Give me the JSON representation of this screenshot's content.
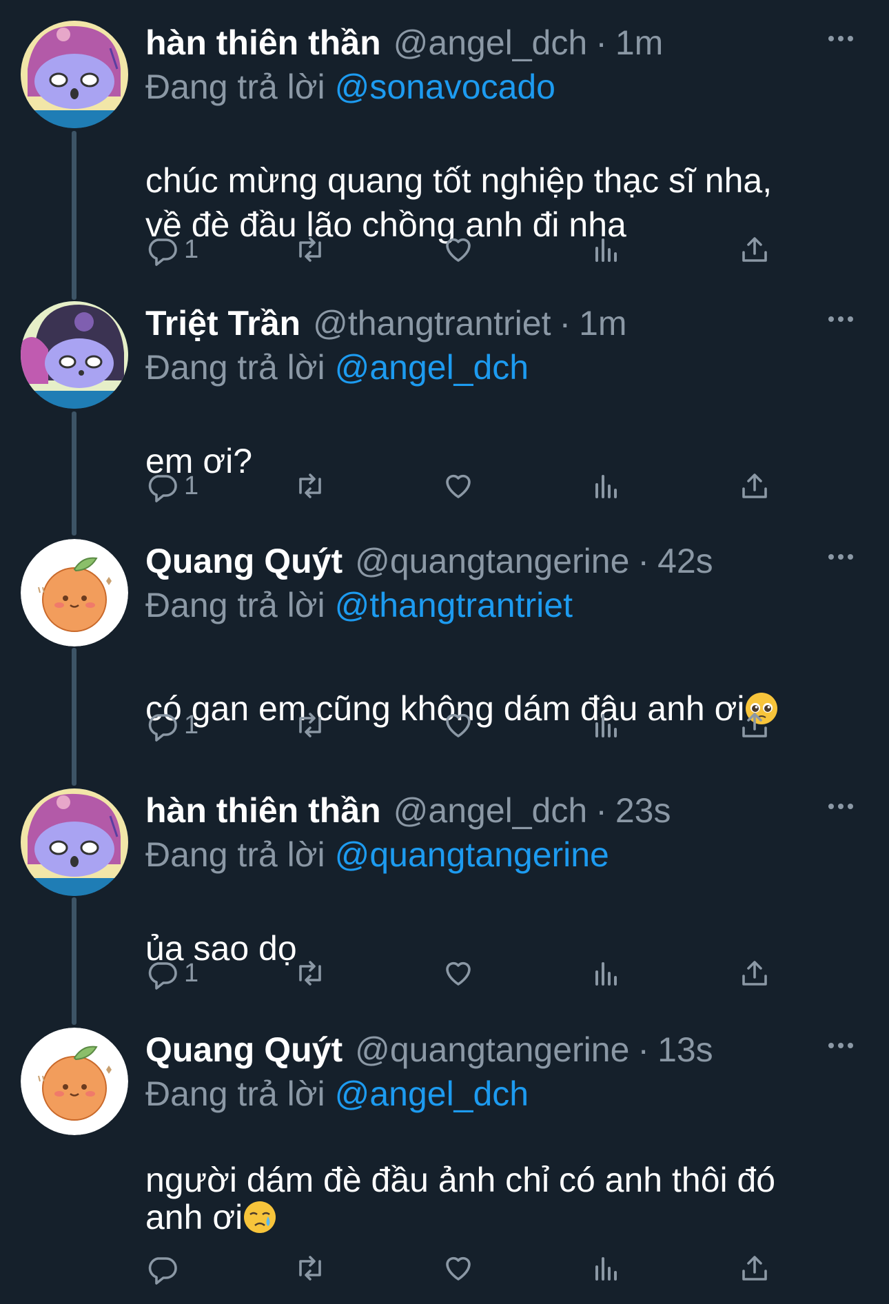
{
  "colors": {
    "background": "#15202b",
    "text": "#ffffff",
    "muted": "#8b98a5",
    "link": "#1d9bf0",
    "thread_line": "#3d5466"
  },
  "tweets": [
    {
      "name": "hàn thiên thần",
      "handle": "@angel_dch",
      "separator": "·",
      "time": "1m",
      "reply_prefix": "Đang trả lời",
      "reply_to": "@sonavocado",
      "text": "chúc mừng quang tốt nghiệp thạc sĩ nha,\nvề đè đầu lão chồng anh đi nha",
      "emoji": "",
      "reply_count": "1",
      "avatar": "melody-avatar"
    },
    {
      "name": "Triệt Trần",
      "handle": "@thangtrantriet",
      "separator": "·",
      "time": "1m",
      "reply_prefix": "Đang trả lời",
      "reply_to": "@angel_dch",
      "text": "em ơi?",
      "emoji": "",
      "reply_count": "1",
      "avatar": "kuromi-avatar"
    },
    {
      "name": "Quang Quýt",
      "handle": "@quangtangerine",
      "separator": "·",
      "time": "42s",
      "reply_prefix": "Đang trả lời",
      "reply_to": "@thangtrantriet",
      "text": "có gan em cũng không dám đâu anh ơi",
      "emoji": "pleading-face",
      "reply_count": "1",
      "avatar": "tangerine-avatar"
    },
    {
      "name": "hàn thiên thần",
      "handle": "@angel_dch",
      "separator": "·",
      "time": "23s",
      "reply_prefix": "Đang trả lời",
      "reply_to": "@quangtangerine",
      "text": "ủa sao dọ",
      "emoji": "",
      "reply_count": "1",
      "avatar": "melody-avatar"
    },
    {
      "name": "Quang Quýt",
      "handle": "@quangtangerine",
      "separator": "·",
      "time": "13s",
      "reply_prefix": "Đang trả lời",
      "reply_to": "@angel_dch",
      "text": "người dám đè đầu ảnh chỉ có anh thôi đó\nanh ơi",
      "emoji": "crying-face",
      "reply_count": "",
      "avatar": "tangerine-avatar"
    }
  ],
  "icons": {
    "reply": "reply-icon",
    "retweet": "retweet-icon",
    "like": "heart-icon",
    "views": "views-icon",
    "share": "share-icon",
    "more": "more-icon"
  }
}
